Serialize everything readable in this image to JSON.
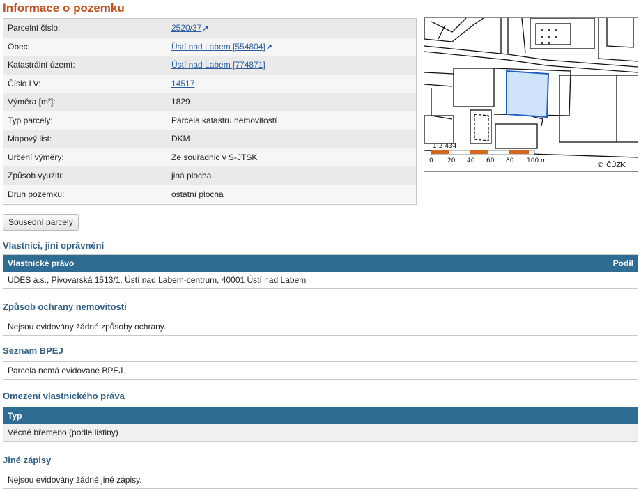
{
  "title": "Informace o pozemku",
  "rows": [
    {
      "label": "Parcelní číslo:",
      "value": "2520/37",
      "link": true,
      "ext": true
    },
    {
      "label": "Obec:",
      "value": "Ústí nad Labem [554804]",
      "link": true,
      "ext": true
    },
    {
      "label": "Katastrální území:",
      "value": "Ústí nad Labem [774871]",
      "link": true,
      "ext": false
    },
    {
      "label": "Číslo LV:",
      "value": "14517",
      "link": true,
      "ext": false
    },
    {
      "label": "Výměra [m²]:",
      "value": "1829",
      "link": false,
      "ext": false
    },
    {
      "label": "Typ parcely:",
      "value": "Parcela katastru nemovitostí",
      "link": false,
      "ext": false
    },
    {
      "label": "Mapový list:",
      "value": "DKM",
      "link": false,
      "ext": false
    },
    {
      "label": "Určení výměry:",
      "value": "Ze souřadnic v S-JTSK",
      "link": false,
      "ext": false
    },
    {
      "label": "Způsob využití:",
      "value": "jiná plocha",
      "link": false,
      "ext": false
    },
    {
      "label": "Druh pozemku:",
      "value": "ostatní plocha",
      "link": false,
      "ext": false
    }
  ],
  "map": {
    "scale": "1:2 434",
    "ticks": [
      "0",
      "20",
      "40",
      "60",
      "80",
      "100 m"
    ],
    "copyright": "© ČÚZK",
    "parcel_color": "#cfe3fb",
    "scale_color": "#d2691e"
  },
  "neighbors_button": "Sousední parcely",
  "owners": {
    "heading": "Vlastníci, jiní oprávnění",
    "col1": "Vlastnické právo",
    "col2": "Podíl",
    "row": "UDES a.s., Pivovarská 1513/1, Ústí nad Labem-centrum, 40001 Ústí nad Labem"
  },
  "protection": {
    "heading": "Způsob ochrany nemovitosti",
    "text": "Nejsou evidovány žádné způsoby ochrany."
  },
  "bpej": {
    "heading": "Seznam BPEJ",
    "text": "Parcela nemá evidované BPEJ."
  },
  "restrictions": {
    "heading": "Omezení vlastnického práva",
    "col1": "Typ",
    "row": "Věcné břemeno (podle listiny)"
  },
  "other": {
    "heading": "Jiné zápisy",
    "text": "Nejsou evidovány žádné jiné zápisy."
  },
  "colors": {
    "title": "#c0501f",
    "section": "#2f5f87",
    "table_header": "#2f6c93"
  }
}
